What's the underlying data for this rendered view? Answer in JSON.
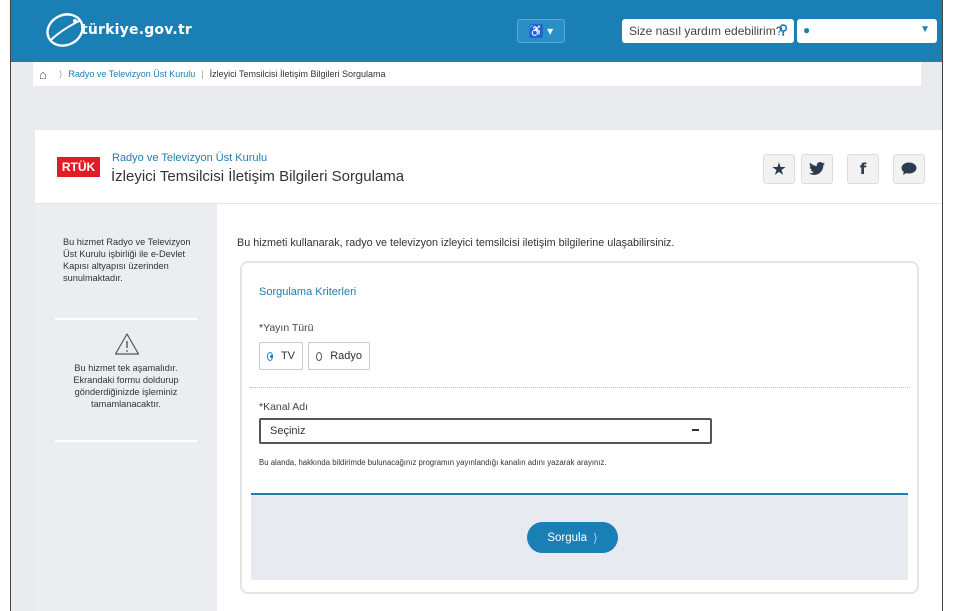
{
  "header": {
    "logo_text": "türkiye.gov.tr",
    "accessibility_label": "♿ ▾",
    "card_label": "▤ ★",
    "search_placeholder": "Size nasıl yardım edebilirim?",
    "user_icon": "person-icon",
    "brand_color": "#1a7fb5"
  },
  "breadcrumb": {
    "items": [
      "Radyo ve Televizyon Üst Kurulu",
      "İzleyici Temsilcisi İletişim Bilgileri Sorgulama"
    ]
  },
  "service": {
    "institution_logo": "RTÜK",
    "institution_name": "Radyo ve Televizyon Üst Kurulu",
    "title": "İzleyici Temsilcisi İletişim Bilgileri Sorgulama",
    "share_icons": [
      "star-icon",
      "twitter-icon",
      "facebook-icon",
      "comment-icon"
    ]
  },
  "sidebar": {
    "info_text": "Bu hizmet Radyo ve Televizyon Üst Kurulu işbirliği ile e-Devlet Kapısı altyapısı üzerinden sunulmaktadır.",
    "note_text": "Bu hizmet tek aşamalıdır. Ekrandaki formu doldurup gönderdiğinizde işleminiz tamamlanacaktır."
  },
  "main": {
    "intro": "Bu hizmeti kullanarak, radyo ve televizyon izleyici temsilcisi iletişim bilgilerine ulaşabilirsiniz.",
    "section_title": "Sorgulama Kriterleri",
    "broadcast_type": {
      "label": "Yayın Türü",
      "required_mark": "*",
      "options": [
        "TV",
        "Radyo"
      ],
      "selected": "TV"
    },
    "channel": {
      "label": "Kanal Adı",
      "required_mark": "*",
      "value": "Seçiniz",
      "hint": "Bu alanda, hakkında bildirimde bulunacağınız programın yayınlandığı kanalın adını yazarak arayınız."
    },
    "submit_label": "Sorgula"
  }
}
